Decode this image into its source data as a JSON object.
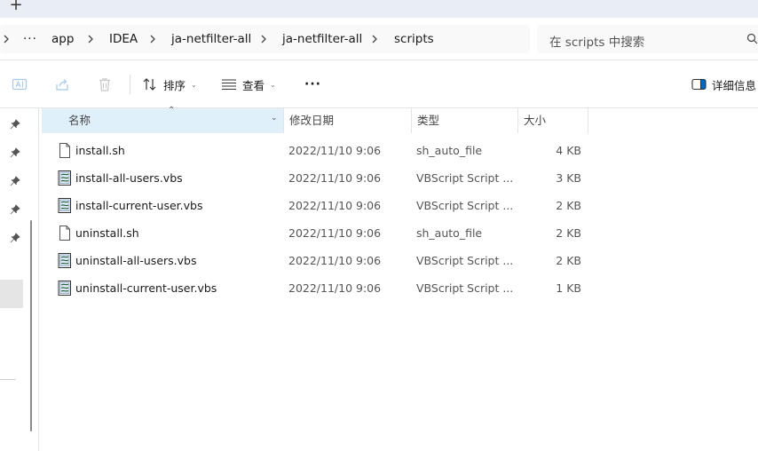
{
  "tabs": {
    "new_tab_glyph": "+"
  },
  "address": {
    "overflow": "···",
    "crumbs": [
      "app",
      "IDEA",
      "ja-netfilter-all",
      "ja-netfilter-all",
      "scripts"
    ]
  },
  "search": {
    "placeholder": "在 scripts 中搜索"
  },
  "toolbar": {
    "sort_label": "排序",
    "view_label": "查看",
    "more_label": "···",
    "details_label": "详细信息"
  },
  "columns": {
    "name": "名称",
    "date": "修改日期",
    "type": "类型",
    "size": "大小"
  },
  "files": [
    {
      "name": "install.sh",
      "date": "2022/11/10 9:06",
      "type": "sh_auto_file",
      "size": "4 KB",
      "icon": "file-icon"
    },
    {
      "name": "install-all-users.vbs",
      "date": "2022/11/10 9:06",
      "type": "VBScript Script ...",
      "size": "3 KB",
      "icon": "vbscript-file-icon"
    },
    {
      "name": "install-current-user.vbs",
      "date": "2022/11/10 9:06",
      "type": "VBScript Script ...",
      "size": "2 KB",
      "icon": "vbscript-file-icon"
    },
    {
      "name": "uninstall.sh",
      "date": "2022/11/10 9:06",
      "type": "sh_auto_file",
      "size": "2 KB",
      "icon": "file-icon"
    },
    {
      "name": "uninstall-all-users.vbs",
      "date": "2022/11/10 9:06",
      "type": "VBScript Script ...",
      "size": "2 KB",
      "icon": "vbscript-file-icon"
    },
    {
      "name": "uninstall-current-user.vbs",
      "date": "2022/11/10 9:06",
      "type": "VBScript Script ...",
      "size": "1 KB",
      "icon": "vbscript-file-icon"
    }
  ],
  "colors": {
    "accent": "#0067c0",
    "header_selected": "#dff0fb"
  }
}
